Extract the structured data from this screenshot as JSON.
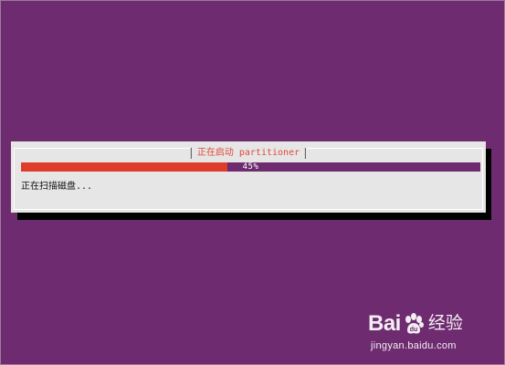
{
  "installer": {
    "title": "正在启动 partitioner",
    "progress": {
      "percent": 45,
      "label": "45%"
    },
    "status": "正在扫描磁盘..."
  },
  "watermark": {
    "brand_left": "Bai",
    "brand_right": "经验",
    "icon": "baidu-paw-icon",
    "url": "jingyan.baidu.com"
  },
  "colors": {
    "background": "#6e2b6f",
    "dialog": "#e6e6e6",
    "title_text": "#e14a3a",
    "progress_fill": "#df3d2c",
    "progress_track": "#6e2b6f",
    "shadow": "#000000"
  }
}
